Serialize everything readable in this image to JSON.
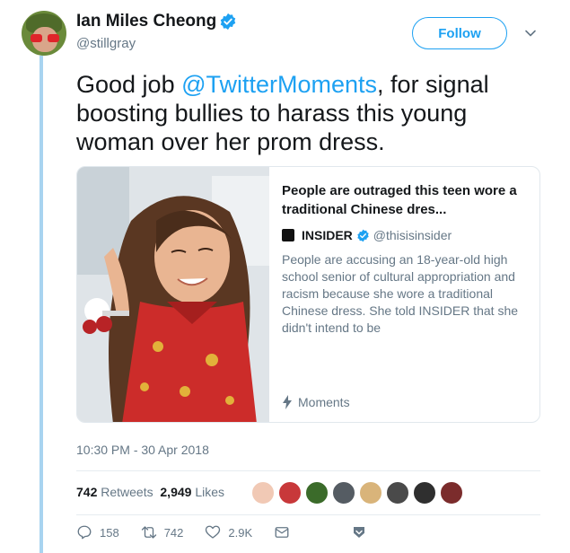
{
  "author": {
    "display_name": "Ian Miles Cheong",
    "handle": "@stillgray",
    "verified": true
  },
  "follow_label": "Follow",
  "tweet": {
    "text_prefix": "Good job ",
    "mention": "@TwitterMoments",
    "text_suffix": ", for signal boosting bullies to harass this young woman over her prom dress."
  },
  "card": {
    "title": "People are outraged this teen wore a traditional Chinese dres...",
    "source_name": "INSIDER",
    "source_handle": "@thisisinsider",
    "description": "People are accusing an 18-year-old high school senior of cultural appropriation and racism because she wore a traditional Chinese dress. She told INSIDER that she didn't intend to be",
    "footer": "Moments"
  },
  "timestamp": "10:30 PM - 30 Apr 2018",
  "stats": {
    "retweets_count": "742",
    "retweets_label": "Retweets",
    "likes_count": "2,949",
    "likes_label": "Likes"
  },
  "likers": [
    "#f1c9b5",
    "#c8383a",
    "#3b6b2a",
    "#555c63",
    "#d9b47a",
    "#4a4a4a",
    "#2f2f2f",
    "#7b2c2c"
  ],
  "actions": {
    "replies": "158",
    "retweets": "742",
    "likes": "2.9K"
  },
  "colors": {
    "accent": "#1da1f2",
    "muted": "#657786",
    "thread_line": "#a8d4f0"
  }
}
